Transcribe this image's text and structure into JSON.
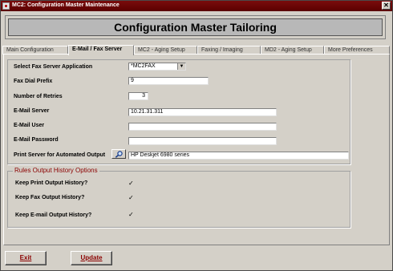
{
  "window": {
    "title": "MC2: Configuration Master Maintenance",
    "close_glyph": "✕"
  },
  "header": {
    "title": "Configuration Master Tailoring"
  },
  "tabs": [
    {
      "label": "Main Configuration",
      "active": false
    },
    {
      "label": "E-Mail / Fax Server",
      "active": true
    },
    {
      "label": "MC2 - Aging Setup",
      "active": false
    },
    {
      "label": "Faxing / Imaging",
      "active": false
    },
    {
      "label": "MD2 - Aging Setup",
      "active": false
    },
    {
      "label": "More Preferences",
      "active": false
    }
  ],
  "form": {
    "fax_app": {
      "label": "Select Fax Server Application",
      "value": "*MC2FAX"
    },
    "fax_prefix": {
      "label": "Fax Dial Prefix",
      "value": "9"
    },
    "retries": {
      "label": "Number of Retries",
      "value": "3"
    },
    "email_server": {
      "label": "E-Mail Server",
      "value": "10.21.31.311"
    },
    "email_user": {
      "label": "E-Mail User",
      "value": ""
    },
    "email_password": {
      "label": "E-Mail Password",
      "value": ""
    },
    "print_server": {
      "label": "Print Server for Automated Output",
      "value": "HP Deskjet 6980 series"
    }
  },
  "rules": {
    "title": "Rules Output History Options",
    "print_history": {
      "label": "Keep Print Output History?",
      "checked": true
    },
    "fax_history": {
      "label": "Keep Fax Output History?",
      "checked": true
    },
    "email_history": {
      "label": "Keep E-mail Output History?",
      "checked": true
    },
    "check_glyph": "✓"
  },
  "buttons": {
    "exit": "Exit",
    "update": "Update"
  },
  "icons": {
    "search": "magnifier-icon",
    "dropdown": "chevron-down-icon"
  },
  "colors": {
    "title_bar": "#6b0707",
    "group_title": "#8b0000",
    "button_text": "#8b0000"
  }
}
